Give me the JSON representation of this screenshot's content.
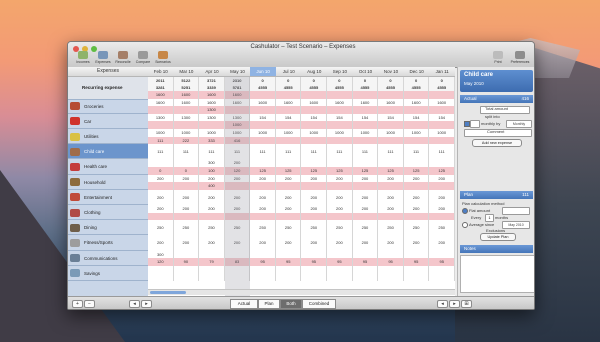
{
  "window": {
    "title": "Cashulator – Test Scenario – Expenses"
  },
  "toolbar": {
    "buttons": [
      {
        "label": "Incomes",
        "color": "#8fb36a"
      },
      {
        "label": "Expenses",
        "color": "#7896b9"
      },
      {
        "label": "Reconcile",
        "color": "#a57f68"
      },
      {
        "label": "Compare",
        "color": "#9a9a9a"
      },
      {
        "label": "Scenarios",
        "color": "#c78747"
      }
    ],
    "right_buttons": [
      {
        "label": "Print",
        "color": "#bcbcbc"
      },
      {
        "label": "Preferences",
        "color": "#8d8d8d"
      }
    ]
  },
  "left_header": "Expenses",
  "months": [
    "Feb 10",
    "Mar 10",
    "Apr 10",
    "May 10",
    "Jun 10",
    "Jul 10",
    "Aug 10",
    "Sep 10",
    "Oct 10",
    "Nov 10",
    "Dec 10",
    "Jan 11"
  ],
  "selected_month_index": 4,
  "summary_rows": [
    {
      "label": "",
      "cells": [
        "2011",
        "5122",
        "3721",
        "2310",
        "0",
        "0",
        "0",
        "0",
        "0",
        "0",
        "0",
        "0"
      ]
    },
    {
      "label": "Recurring expense",
      "cells": [
        "3281",
        "5251",
        "3339",
        "5781",
        "4555",
        "4555",
        "4555",
        "4555",
        "4555",
        "4555",
        "4555",
        "4555"
      ]
    },
    {
      "label": "",
      "cells": [
        "1600",
        "1600",
        "1600",
        "1600",
        "",
        "",
        "",
        "",
        "",
        "",
        "",
        ""
      ]
    }
  ],
  "categories": [
    {
      "name": "Groceries",
      "color": "#b64c34",
      "rows": [
        [
          "1600",
          "1600",
          "1600",
          "1600",
          "1600",
          "1600",
          "1600",
          "1600",
          "1600",
          "1600",
          "1600",
          "1600"
        ],
        [
          "",
          "",
          "1300",
          "",
          "",
          "",
          "",
          "",
          "",
          "",
          "",
          ""
        ]
      ]
    },
    {
      "name": "Car",
      "color": "#d0332c",
      "rows": [
        [
          "1300",
          "1300",
          "1300",
          "1300",
          "154",
          "154",
          "154",
          "154",
          "154",
          "154",
          "154",
          "154"
        ],
        [
          "",
          "",
          "",
          "1000",
          "",
          "",
          "",
          "",
          "",
          "",
          "",
          ""
        ]
      ]
    },
    {
      "name": "Utilities",
      "color": "#d9c144",
      "rows": [
        [
          "1000",
          "1000",
          "1000",
          "1000",
          "1000",
          "1000",
          "1000",
          "1000",
          "1000",
          "1000",
          "1000",
          "1000"
        ],
        [
          "111",
          "222",
          "333",
          "416",
          "",
          "",
          "",
          "",
          "",
          "",
          "",
          ""
        ]
      ]
    },
    {
      "name": "Child care",
      "color": "#a06c49",
      "selected": true,
      "rows": [
        [
          "111",
          "111",
          "111",
          "111",
          "111",
          "111",
          "111",
          "111",
          "111",
          "111",
          "111",
          "111"
        ]
      ]
    },
    {
      "name": "Health care",
      "color": "#c43c3c",
      "rows": [
        [
          "",
          "",
          "300",
          "200",
          "",
          "",
          "",
          "",
          "",
          "",
          "",
          ""
        ],
        [
          "0",
          "0",
          "100",
          "120",
          "125",
          "125",
          "125",
          "125",
          "125",
          "125",
          "125",
          "125"
        ]
      ]
    },
    {
      "name": "Household",
      "color": "#8d6b3d",
      "rows": [
        [
          "200",
          "200",
          "200",
          "200",
          "200",
          "200",
          "200",
          "200",
          "200",
          "200",
          "200",
          "200"
        ],
        [
          "",
          "",
          "400",
          "",
          "",
          "",
          "",
          "",
          "",
          "",
          "",
          ""
        ]
      ]
    },
    {
      "name": "Entertainment",
      "color": "#c04a3a",
      "rows": [
        [
          "200",
          "200",
          "200",
          "200",
          "200",
          "200",
          "200",
          "200",
          "200",
          "200",
          "200",
          "200"
        ]
      ]
    },
    {
      "name": "Clothing",
      "color": "#b04b46",
      "rows": [
        [
          "200",
          "200",
          "200",
          "200",
          "200",
          "200",
          "200",
          "200",
          "200",
          "200",
          "200",
          "200"
        ],
        [
          "",
          "",
          "",
          "",
          "",
          "",
          "",
          "",
          "",
          "",
          "",
          ""
        ]
      ]
    },
    {
      "name": "Dining",
      "color": "#6f5f4b",
      "rows": [
        [
          "250",
          "250",
          "250",
          "250",
          "250",
          "250",
          "250",
          "250",
          "250",
          "250",
          "250",
          "250"
        ]
      ]
    },
    {
      "name": "Fitness/Sports",
      "color": "#9d9d9d",
      "rows": [
        [
          "200",
          "200",
          "200",
          "200",
          "200",
          "200",
          "200",
          "200",
          "200",
          "200",
          "200",
          "200"
        ]
      ]
    },
    {
      "name": "Communications",
      "color": "#6a7f96",
      "rows": [
        [
          "300",
          "",
          "",
          "",
          "",
          "",
          "",
          "",
          "",
          "",
          "",
          ""
        ],
        [
          "120",
          "90",
          "79",
          "83",
          "95",
          "95",
          "95",
          "95",
          "95",
          "95",
          "95",
          "95"
        ]
      ]
    },
    {
      "name": "Savings",
      "color": "#7a9ab7",
      "rows": [
        [
          "",
          "",
          "",
          "",
          "",
          "",
          "",
          "",
          "",
          "",
          "",
          ""
        ]
      ]
    }
  ],
  "bottom_tabs": [
    {
      "label": "Actual",
      "active": false
    },
    {
      "label": "Plan",
      "active": false
    },
    {
      "label": "Both",
      "active": true
    },
    {
      "label": "Combined",
      "active": false
    }
  ],
  "sidebar": {
    "title": "Child care",
    "subtitle": "May 2010",
    "actual_label": "Actual",
    "actual_value": "416",
    "total_amount_label": "Total amount",
    "split_into_label": "split into",
    "monthly_checkbox_label": "monthly by",
    "monthly_dropdown": "Monthly",
    "comment_label": "Comment",
    "add_button": "Add new expense",
    "plan_label": "Plan",
    "plan_value": "111",
    "method_label": "Plan calculation method",
    "flat_amount_label": "Flat amount",
    "every_label": "Every",
    "months_label": "months",
    "months_value": "1",
    "average_label": "Average since",
    "average_dropdown": "May 2010",
    "exclusions_label": "Exclusions",
    "update_button": "Update Plan",
    "notes_label": "Notes"
  },
  "colors": {
    "row_pink": "#f4c6cb",
    "row_white": "#ffffff",
    "row_light": "#f7f1f2",
    "summary_bg": "#f5f5f5"
  }
}
